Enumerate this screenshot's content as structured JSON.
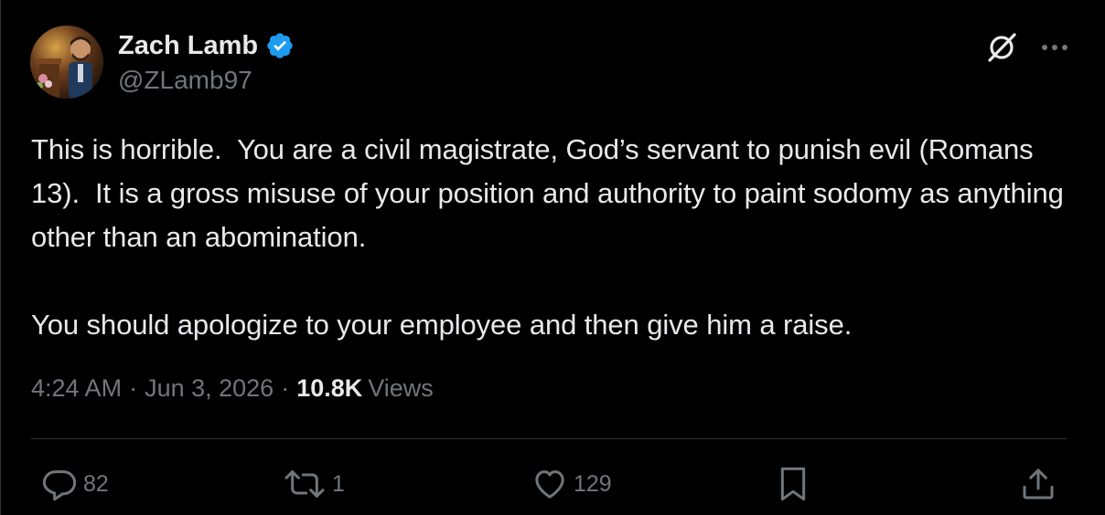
{
  "author": {
    "display_name": "Zach Lamb",
    "handle": "@ZLamb97",
    "verified": true,
    "verified_color": "#1d9bf0"
  },
  "tweet": {
    "paragraphs": [
      "This is horrible.  You are a civil magistrate, God’s servant to punish evil (Romans 13).  It is a gross misuse of your position and authority to paint sodomy as anything other than an abomination.",
      "You should apologize to your employee and then give him a raise."
    ],
    "time": "4:24 AM",
    "date": "Jun 3, 2026",
    "separator": "·",
    "views_count": "10.8K",
    "views_label": "Views"
  },
  "actions": {
    "replies": "82",
    "reposts": "1",
    "likes": "129"
  },
  "icons": {
    "grok": "grok-icon",
    "more": "more-icon",
    "reply": "reply-icon",
    "repost": "repost-icon",
    "like": "heart-icon",
    "bookmark": "bookmark-icon",
    "share": "share-icon"
  },
  "colors": {
    "background": "#000000",
    "text": "#e7e9ea",
    "secondary": "#71767b",
    "divider": "#2f3336"
  }
}
